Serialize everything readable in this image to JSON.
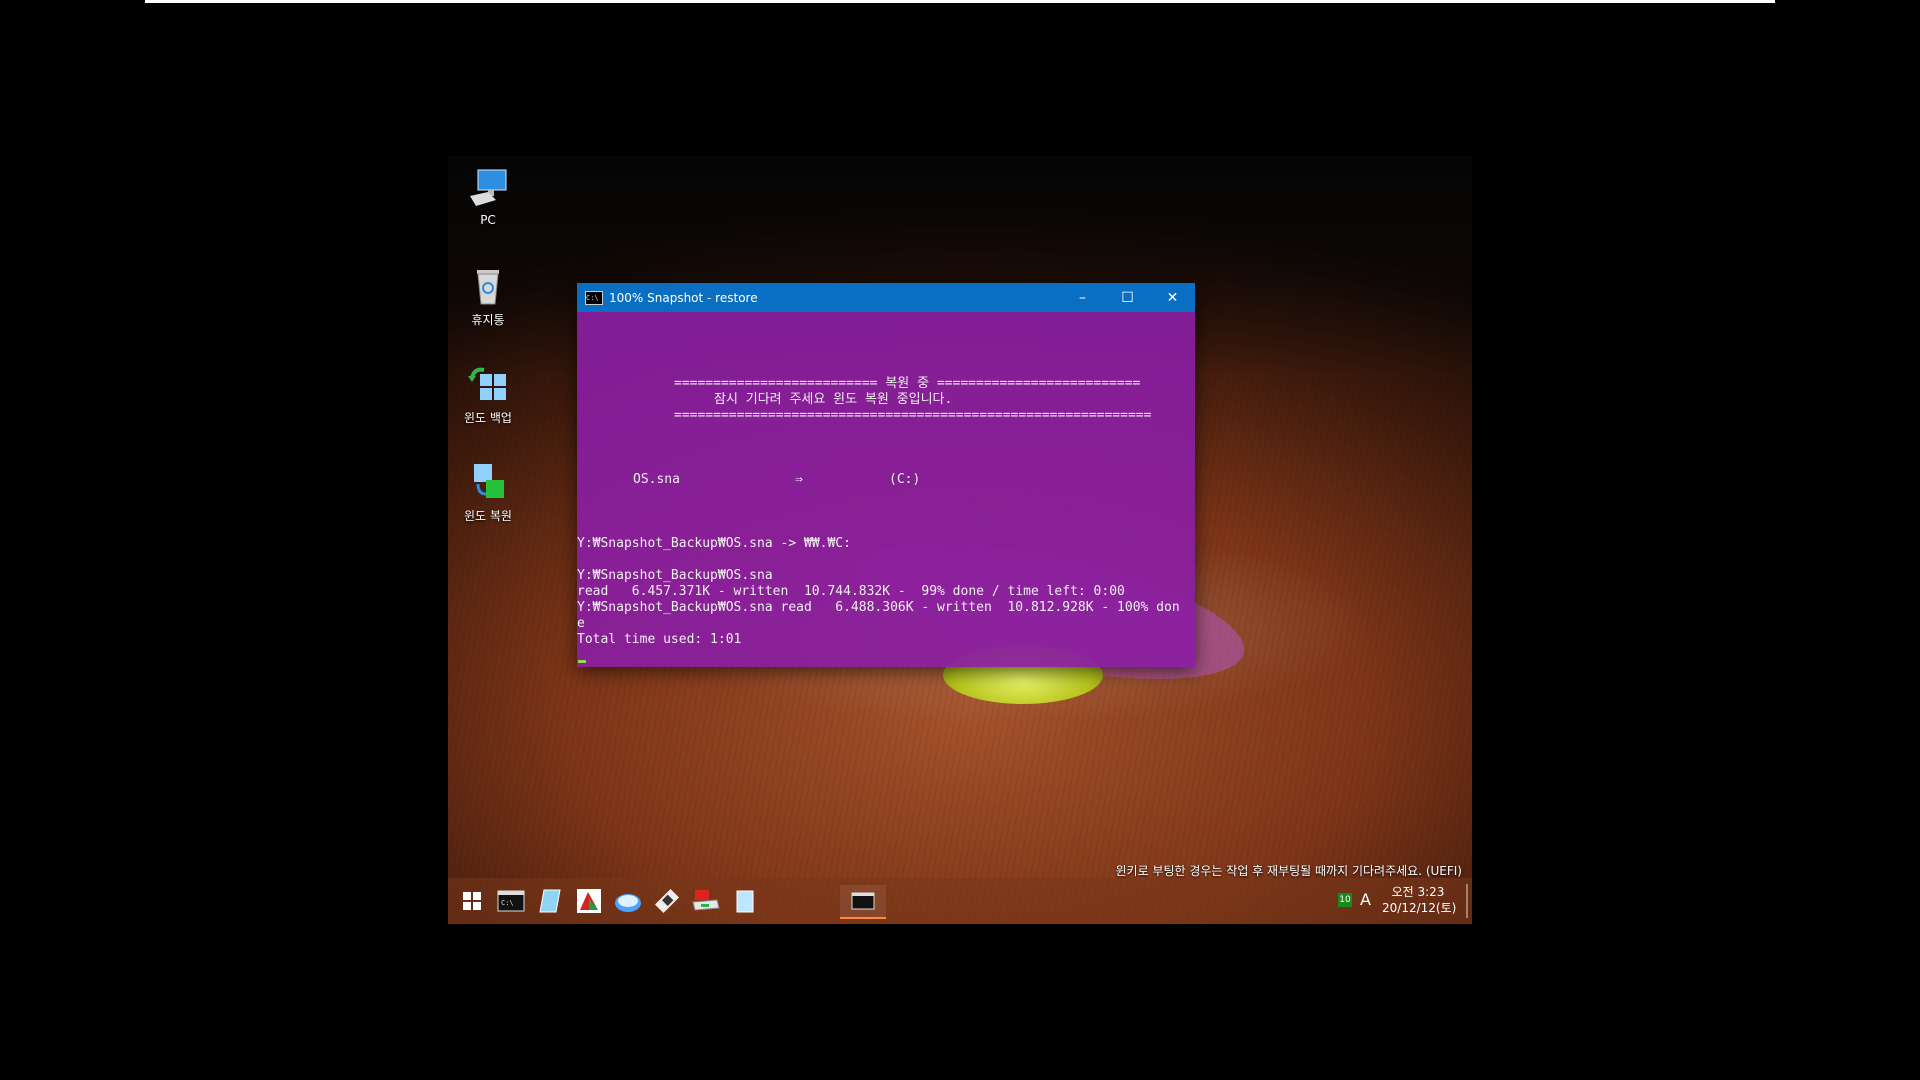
{
  "desktop_icons": [
    {
      "label": "PC",
      "icon": "computer-icon"
    },
    {
      "label": "휴지통",
      "icon": "recycle-bin-icon"
    },
    {
      "label": "윈도 백업",
      "icon": "windows-backup-icon"
    },
    {
      "label": "윈도 복원",
      "icon": "windows-restore-icon"
    }
  ],
  "window": {
    "title": "100% Snapshot - restore",
    "buttons": {
      "minimize": "–",
      "maximize": "☐",
      "close": "✕"
    }
  },
  "console": {
    "lines": [
      "========================== 복원 중 ==========================",
      "잠시 기다려 주세요 윈도 복원 중입니다.",
      "=============================================================",
      "OS.sna",
      "⇒",
      "(C:)",
      "Y:₩Snapshot_Backup₩OS.sna -> ₩₩.₩C:",
      "Y:₩Snapshot_Backup₩OS.sna",
      "read   6.457.371K - written  10.744.832K -  99% done / time left: 0:00",
      "Y:₩Snapshot_Backup₩OS.sna read   6.488.306K - written  10.812.928K - 100% don",
      "e",
      "Total time used: 1:01"
    ]
  },
  "status_message": "윈키로 부팅한 경우는 작업 후 재부팅될 때까지 기다려주세요. (UEFI)",
  "taskbar": {
    "items": [
      "start-icon",
      "cmd-icon",
      "notepad-icon",
      "partition-tool-icon",
      "disk-icon",
      "usb-icon",
      "drive-icon",
      "clipboard-icon"
    ],
    "active_window_icon": "cmd-icon",
    "tray": {
      "badge": "10",
      "ime": "A",
      "time": "오전 3:23",
      "date": "20/12/12(토)"
    }
  },
  "colors": {
    "titlebar": "#0a6fc2",
    "console_bg": "#8a1ea0",
    "cursor": "#8ee04a"
  }
}
